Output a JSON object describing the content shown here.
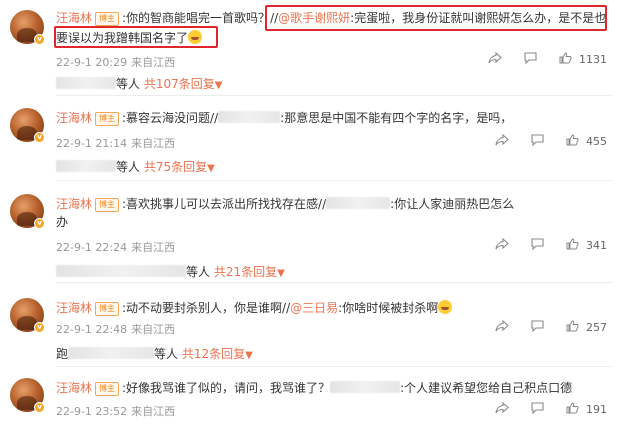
{
  "comments": [
    {
      "username": "汪海林",
      "tag": "博主",
      "line1": [
        {
          "t": "text",
          "v": ":你的智商能唱完一首歌吗？"
        },
        {
          "t": "text",
          "v": "//"
        },
        {
          "t": "at",
          "v": "@歌手谢熙妍"
        },
        {
          "t": "text",
          "v": ":完蛋啦，我身份证就叫谢熙妍怎么办，是不是也"
        }
      ],
      "line2": "要误以为我蹭韩国名字了",
      "time": "22-9-1 20:29",
      "location": "来自江西",
      "likes": "1131",
      "reply_count_text": "共107条回复",
      "reply_suffix": "等人"
    },
    {
      "username": "汪海林",
      "tag": "博主",
      "line1": [
        {
          "t": "text",
          "v": ":慕容云海没问题//"
        },
        {
          "t": "text",
          "v": ":那意思是中国不能有四个字的名字，是吗，"
        }
      ],
      "time": "22-9-1 21:14",
      "location": "来自江西",
      "likes": "455",
      "reply_count_text": "共75条回复",
      "reply_suffix": "等人"
    },
    {
      "username": "汪海林",
      "tag": "博主",
      "line1": [
        {
          "t": "text",
          "v": ":喜欢挑事儿可以去派出所找找存在感//"
        },
        {
          "t": "text",
          "v": ":你让人家迪丽热巴怎么"
        }
      ],
      "line2": "办",
      "time": "22-9-1 22:24",
      "location": "来自江西",
      "likes": "341",
      "reply_count_text": "共21条回复",
      "reply_suffix": "等人"
    },
    {
      "username": "汪海林",
      "tag": "博主",
      "line1": [
        {
          "t": "text",
          "v": ":动不动要封杀别人，你是谁啊//"
        },
        {
          "t": "at",
          "v": "@三日易"
        },
        {
          "t": "text",
          "v": ":你啥时候被封杀啊"
        }
      ],
      "time": "22-9-1 22:48",
      "location": "来自江西",
      "likes": "257",
      "reply_count_text": "共12条回复",
      "reply_suffix": "等人",
      "reply_prefix": "跑"
    },
    {
      "username": "汪海林",
      "tag": "博主",
      "line1": [
        {
          "t": "text",
          "v": ":好像我骂谁了似的，请问，我骂谁了？"
        },
        {
          "t": "text",
          "v": ":个人建议希望您给自己积点口德"
        }
      ],
      "time": "22-9-1 23:52",
      "location": "来自江西",
      "likes": "191"
    }
  ],
  "colors": {
    "username": "#eb7350",
    "highlight_box": "#e0262b",
    "meta": "#999999",
    "tag_border": "#f0a85c"
  },
  "icons": [
    "share-icon",
    "comment-icon",
    "like-icon",
    "emoji-laugh-icon",
    "reply-arrow-icon"
  ]
}
